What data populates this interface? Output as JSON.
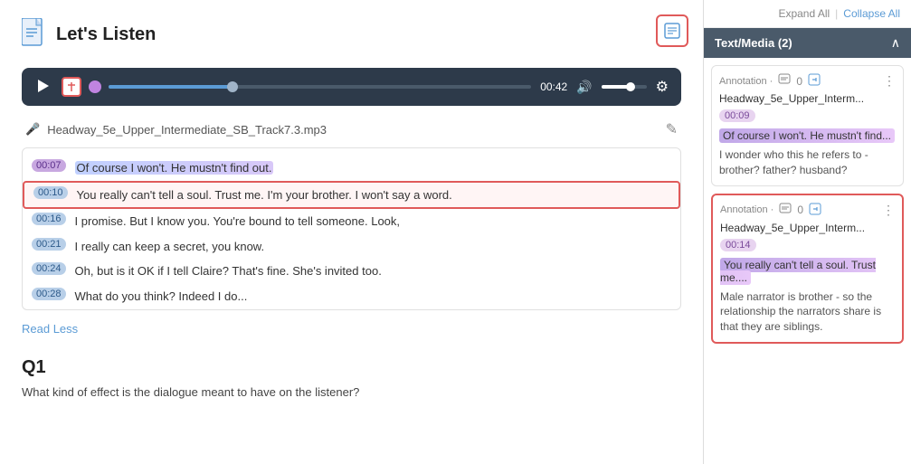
{
  "page": {
    "title": "Let's Listen",
    "sticky_note_label": "sticky note"
  },
  "audio": {
    "filename": "Headway_5e_Upper_Intermediate_SB_Track7.3.mp3",
    "time_display": "00:42",
    "play_label": "play"
  },
  "transcript": {
    "rows": [
      {
        "id": 1,
        "timestamp": "00:07",
        "text": "Of course I won't. He mustn't find out.",
        "highlight": "purple",
        "selected": false
      },
      {
        "id": 2,
        "timestamp": "00:10",
        "text": "You really can't tell a soul. Trust me. I'm your brother. I won't say a word.",
        "highlight": "none",
        "selected": true
      },
      {
        "id": 3,
        "timestamp": "00:16",
        "text": "I promise. But I know you. You're bound to tell someone. Look,",
        "highlight": "none",
        "selected": false
      },
      {
        "id": 4,
        "timestamp": "00:21",
        "text": "I really can keep a secret, you know.",
        "highlight": "none",
        "selected": false
      },
      {
        "id": 5,
        "timestamp": "00:24",
        "text": "Oh, but is it OK if I tell Claire? That's fine. She's invited too.",
        "highlight": "none",
        "selected": false
      },
      {
        "id": 6,
        "timestamp": "00:28",
        "text": "What do you think? Indeed I do...",
        "highlight": "none",
        "selected": false
      }
    ],
    "read_less_label": "Read Less"
  },
  "q1": {
    "label": "Q1",
    "text": "What kind of effect is the dialogue meant to have on the listener?"
  },
  "sidebar": {
    "toolbar": {
      "expand_all": "Expand All",
      "collapse_all": "Collapse All",
      "divider": "|"
    },
    "header": {
      "title": "Text/Media (2)"
    },
    "annotations": [
      {
        "id": 1,
        "meta_icon": "💬",
        "count": "0",
        "action_icon": "⋮",
        "filename": "Headway_5e_Upper_Interm...",
        "timestamp": "00:09",
        "quote": "Of course I won't. He mustn't find...",
        "note": "I wonder who this he refers to - brother? father? husband?",
        "selected": false
      },
      {
        "id": 2,
        "meta_icon": "💬",
        "count": "0",
        "action_icon": "⋮",
        "filename": "Headway_5e_Upper_Interm...",
        "timestamp": "00:14",
        "quote": "You really can't tell a soul. Trust me....",
        "note": "Male narrator is brother - so the relationship the narrators share is that they are siblings.",
        "selected": true
      }
    ]
  }
}
